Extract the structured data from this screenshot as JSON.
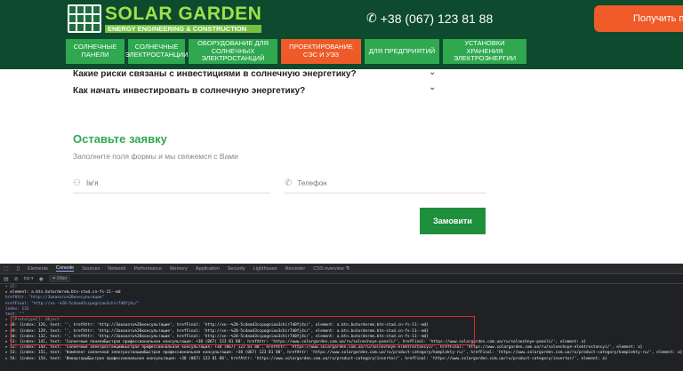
{
  "header": {
    "logo_title": "SOLAR GARDEN",
    "logo_subtitle": "ENERGY ENGINEERING & CONSTRUCTION",
    "phone": "+38 (067) 123 81 88",
    "cta_label": "Получить по"
  },
  "nav": [
    {
      "label": "СОЛНЕЧНЫЕ ПАНЕЛИ",
      "width": 66
    },
    {
      "label": "СОЛНЕЧНЫЕ ЭЛЕКТРОСТАНЦИИ",
      "width": 64
    },
    {
      "label": "ОБОРУДОВАНИЕ ДЛЯ СОЛНЕЧНЫХ ЭЛЕКТРОСТАНЦИЙ",
      "width": 100
    },
    {
      "label": "ПРОЕКТИРОВАНИЕ СЭС И УЭЗ",
      "width": 90,
      "active": true
    },
    {
      "label": "ДЛЯ ПРЕДПРИЯТИЙ",
      "width": 84
    },
    {
      "label": "УСТАНОВКИ ХРАНЕНИЯ ЭЛЕКТРОЭНЕРГИИ",
      "width": 94
    }
  ],
  "faq": [
    "Какие риски связаны с инвестициями в солнечную энергетику?",
    "Как начать инвестировать в солнечную энергетику?"
  ],
  "form": {
    "title": "Оставьте заявку",
    "subtitle": "Заполните поля формы и мы свяжемся с Вами",
    "name_placeholder": "Ім'я",
    "phone_placeholder": "Телефон",
    "submit_label": "Замовити"
  },
  "devtools": {
    "tabs": [
      "Elements",
      "Console",
      "Sources",
      "Network",
      "Performance",
      "Memory",
      "Application",
      "Security",
      "Lighthouse",
      "Recorder",
      "CSS overview ⚗"
    ],
    "active_tab": "Console",
    "context": "top",
    "filter_placeholder": "Filter",
    "lines": [
      {
        "cls": "k",
        "text": "▾ 47:"
      },
      {
        "cls": "",
        "text": "    ▸ element: a.btn.butorderem.btn-stud.cn-fs-11--md"
      },
      {
        "cls": "s",
        "text": "      hrefAttr: \"http://3акаазть%20консультацие\""
      },
      {
        "cls": "s",
        "text": "      hrefFinal: \"http://xn--%20-5cdaad3ccpogniao3chir7d0fj4c/\""
      },
      {
        "cls": "p",
        "text": "      index: 133"
      },
      {
        "cls": "s",
        "text": "      text: \"\""
      },
      {
        "cls": "k",
        "text": "    ▸ [[Prototype]]: Object"
      },
      {
        "cls": "",
        "text": "▸ 48: {index: 126, text: '', hrefAttr: 'http://3акаазть%20консультацие', hrefFinal: 'http://xn--%20-5cdaad3ccpogniao3chir7d0fj4c/', element: a.btn.butorderem.btn-stud.cn-fs-11--md}"
      },
      {
        "cls": "",
        "text": "▸ 49: {index: 129, text: '', hrefAttr: 'http://3акаазть%20консультацие', hrefFinal: 'http://xn--%20-5cdaad3ccpogniao3chir7d0fj4c/', element: a.btn.butorderem.btn-stud.cn-fs-11--md}"
      },
      {
        "cls": "",
        "text": "▸ 50: {index: 132, text: '', hrefAttr: 'http://3акаазть%20консультацие', hrefFinal: 'http://xn--%20-5cdaad3ccpogniao3chir7d0fj4c/', element: a.btn.butorderem.btn-stud.cn-fs-11--md}"
      },
      {
        "cls": "",
        "text": "▸ 51: {index: 141, text: 'Солнечные панелиБыстрая профессиональная консультация: +38 (067) 123 81 88', hrefAttr: 'https://www.solargarden.com.ua/ru/solnechnye-paneli/', hrefFinal: 'https://www.solargarden.com.ua/ru/solnechnye-paneli/', element: a}"
      },
      {
        "cls": "",
        "text": "▸ 52: {index: 144, text: 'Солнечные электростанцииБыстрая профессиональная консультация: +38 (067) 123 81 88', hrefAttr: 'https://www.solargarden.com.ua/ru/solnechnye-elektrostancyi/', hrefFinal: 'https://www.solargarden.com.ua/ru/solnechnye-elektrostancyi/', element: a}"
      },
      {
        "cls": "",
        "text": "▸ 53: {index: 151, text: 'Комплект солнечной электростанцииБыстрая профессиональная консультация: +38 (067) 123 81 88', hrefAttr: 'https://www.solargarden.com.ua/ru/product-category/komplekty-ru/', hrefFinal: 'https://www.solargarden.com.ua/ru/product-category/komplekty-ru/', element: a}"
      },
      {
        "cls": "",
        "text": "▸ 54: {index: 154, text: 'ИнверторыБыстрая профессиональная консультация: +38 (067) 123 81 88', hrefAttr: 'https://www.solargarden.com.ua/ru/product-category/invertor/', hrefFinal: 'https://www.solargarden.com.ua/ru/product-category/invertor/', element: a}"
      }
    ]
  }
}
